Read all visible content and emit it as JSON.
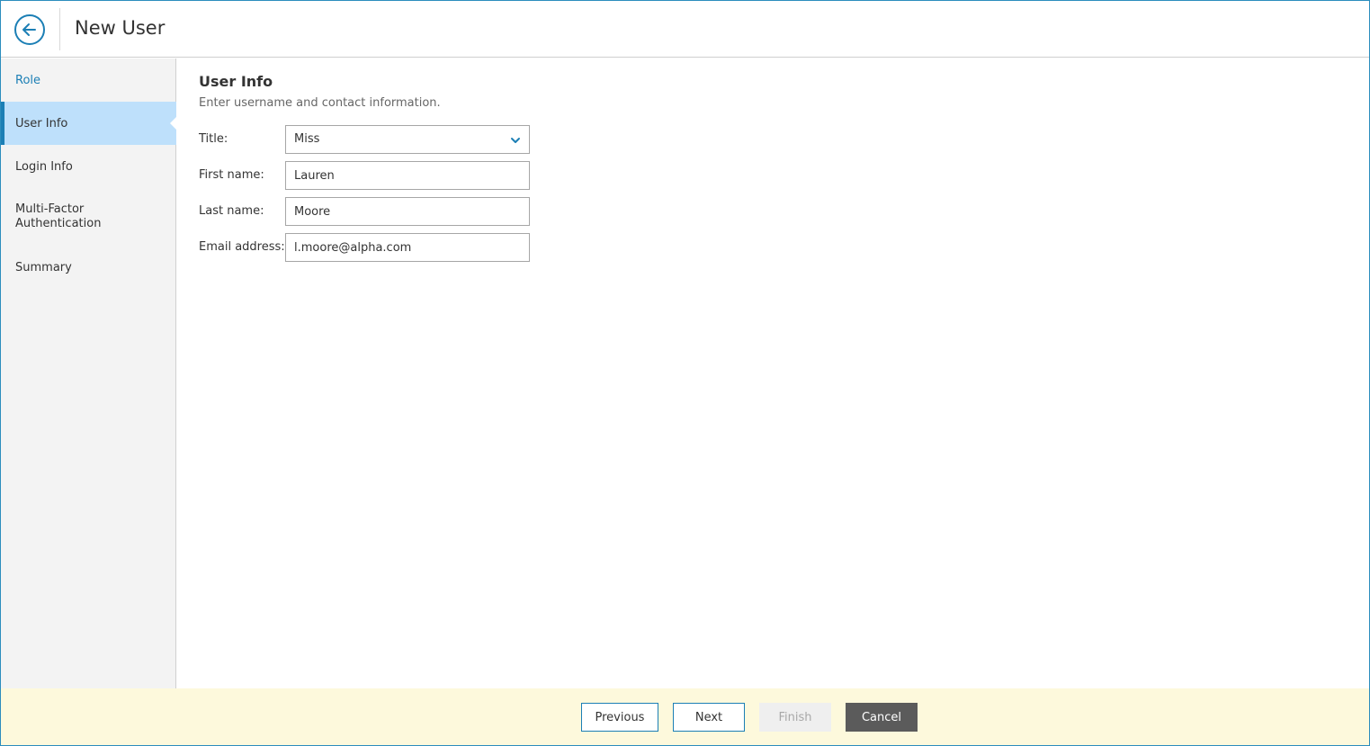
{
  "header": {
    "title": "New User",
    "back_icon": "arrow-left-circle-icon"
  },
  "sidebar": {
    "items": [
      {
        "label": "Role"
      },
      {
        "label": "User Info"
      },
      {
        "label": "Login Info"
      },
      {
        "label": "Multi-Factor Authentication"
      },
      {
        "label": "Summary"
      }
    ]
  },
  "main": {
    "title": "User Info",
    "description": "Enter username and contact information.",
    "fields": {
      "title": {
        "label": "Title:",
        "value": "Miss"
      },
      "first_name": {
        "label": "First name:",
        "value": "Lauren"
      },
      "last_name": {
        "label": "Last name:",
        "value": "Moore"
      },
      "email": {
        "label": "Email address:",
        "value": "l.moore@alpha.com"
      }
    }
  },
  "footer": {
    "previous_label": "Previous",
    "next_label": "Next",
    "finish_label": "Finish",
    "cancel_label": "Cancel"
  },
  "colors": {
    "accent": "#1c7fb5",
    "active_nav_bg": "#bee0fb",
    "footer_bg": "#fdf9dc",
    "cancel_bg": "#5b5b5b"
  }
}
